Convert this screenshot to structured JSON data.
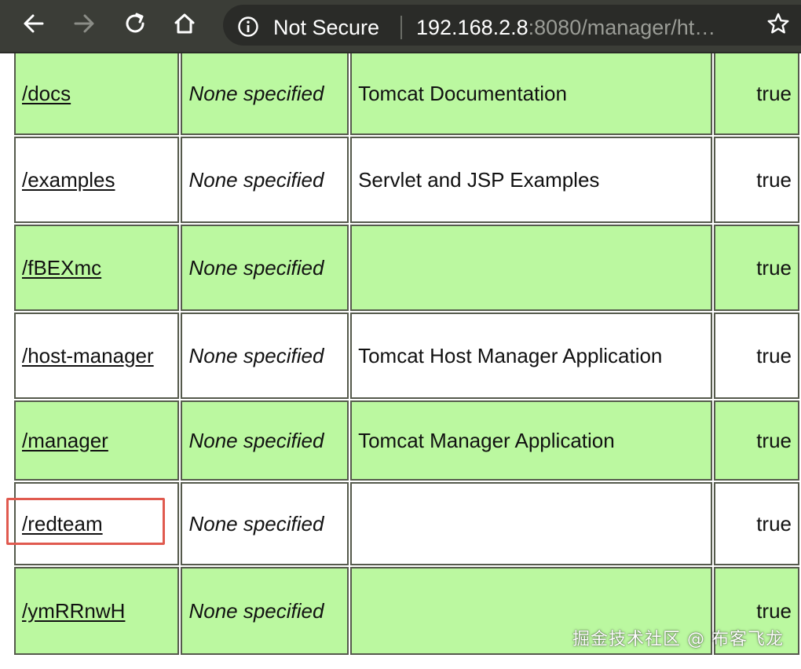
{
  "browser": {
    "security_label": "Not Secure",
    "url_host": "192.168.2.8",
    "url_rest": ":8080/manager/ht…",
    "colors": {
      "toolbar": "#3b3d37",
      "omnibox": "#2a2b28",
      "host_text": "#ffffff",
      "rest_text": "#9a9c96"
    }
  },
  "table": {
    "colors": {
      "green_row": "#bbf8a0",
      "white_row": "#ffffff",
      "border": "#555a4c"
    },
    "rows": [
      {
        "path": "/docs",
        "version": "None specified",
        "display_name": "Tomcat Documentation",
        "running": "true",
        "style": "green"
      },
      {
        "path": "/examples",
        "version": "None specified",
        "display_name": "Servlet and JSP Examples",
        "running": "true",
        "style": "white"
      },
      {
        "path": "/fBEXmc",
        "version": "None specified",
        "display_name": "",
        "running": "true",
        "style": "green"
      },
      {
        "path": "/host-manager",
        "version": "None specified",
        "display_name": "Tomcat Host Manager Application",
        "running": "true",
        "style": "white"
      },
      {
        "path": "/manager",
        "version": "None specified",
        "display_name": "Tomcat Manager Application",
        "running": "true",
        "style": "green"
      },
      {
        "path": "/redteam",
        "version": "None specified",
        "display_name": "",
        "running": "true",
        "style": "white",
        "highlighted": true
      },
      {
        "path": "/ymRRnwH",
        "version": "None specified",
        "display_name": "",
        "running": "true",
        "style": "green"
      }
    ]
  },
  "annotation": {
    "color": "#e05a4f"
  },
  "watermark": "掘金技术社区 @ 布客飞龙"
}
